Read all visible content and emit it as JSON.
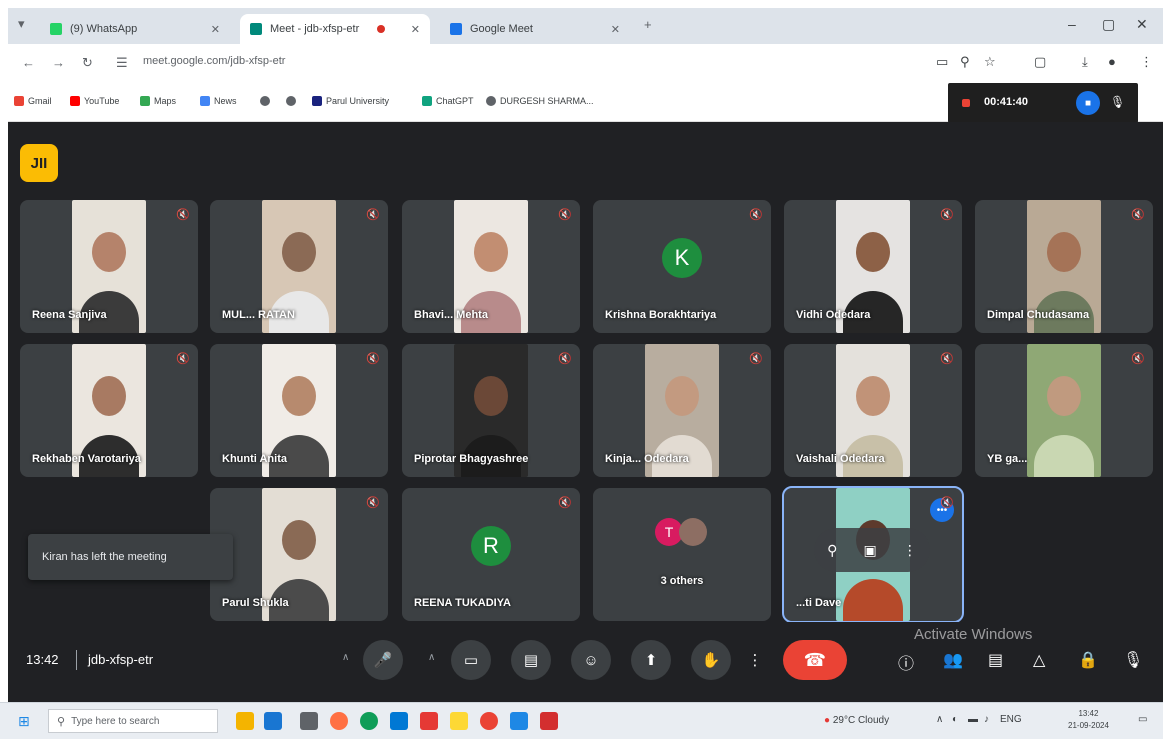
{
  "browser": {
    "tabs": [
      {
        "label": "(9) WhatsApp",
        "favicon_color": "#25d366"
      },
      {
        "label": "Meet - jdb-xfsp-etr",
        "favicon_color": "#00897b"
      },
      {
        "label": "Google Meet",
        "favicon_color": "#1a73e8"
      }
    ],
    "url": "meet.google.com/jdb-xfsp-etr",
    "bookmarks": [
      "Gmail",
      "YouTube",
      "Maps",
      "News",
      "Parul University",
      "ChatGPT",
      "DURGESH SHARMA..."
    ],
    "window_controls": {
      "minimize": "–",
      "maximize": "▢",
      "close": "✕"
    }
  },
  "recording": {
    "time": "00:41:40"
  },
  "meet": {
    "logo_label": "JII",
    "toast": "Kiran has left the meeting",
    "participants": [
      {
        "name": "Reena Sanjiva",
        "type": "video",
        "bg": "#e6e1d8",
        "skin": "#b5836b",
        "shirt": "#3b3b3b"
      },
      {
        "name": "MUL... RATAN",
        "type": "video",
        "bg": "#d7c7b5",
        "skin": "#8b6a55",
        "shirt": "#e8e8e8"
      },
      {
        "name": "Bhavi... Mehta",
        "type": "video",
        "bg": "#ece7e1",
        "skin": "#c28e72",
        "shirt": "#b88b8b"
      },
      {
        "name": "Krishna Borakhtariya",
        "type": "avatar",
        "initial": "K",
        "avatar_color": "#1e8e3e"
      },
      {
        "name": "Vidhi Odedara",
        "type": "video",
        "bg": "#e5e3e1",
        "skin": "#8d6147",
        "shirt": "#262626"
      },
      {
        "name": "Dimpal Chudasama",
        "type": "video",
        "bg": "#b9a995",
        "skin": "#a57357",
        "shirt": "#6d7a5e"
      },
      {
        "name": "Rekhaben Varotariya",
        "type": "video",
        "bg": "#ebe6df",
        "skin": "#a87a62",
        "shirt": "#2d2d2d"
      },
      {
        "name": "Khunti Anita",
        "type": "video",
        "bg": "#f0ece7",
        "skin": "#b78a6e",
        "shirt": "#4a4a4a"
      },
      {
        "name": "Piprotar Bhagyashree",
        "type": "video",
        "bg": "#2a2a2a",
        "skin": "#6b4837",
        "shirt": "#1c1c1c"
      },
      {
        "name": "Kinja... Odedara",
        "type": "video",
        "bg": "#b8ad9f",
        "skin": "#c39a80",
        "shirt": "#e2dbd2"
      },
      {
        "name": "Vaishali Odedara",
        "type": "video",
        "bg": "#e4e1dc",
        "skin": "#c19378",
        "shirt": "#c8c0a8"
      },
      {
        "name": "YB ga...",
        "type": "video",
        "bg": "#8fa875",
        "skin": "#c09a7f",
        "shirt": "#c9d7b2"
      },
      {
        "name": "Parul Shukla",
        "type": "video",
        "bg": "#e3ddd4",
        "skin": "#8a6a55",
        "shirt": "#4b4b4b"
      },
      {
        "name": "REENA TUKADIYA",
        "type": "avatar",
        "initial": "R",
        "avatar_color": "#1e8e3e"
      },
      {
        "name": "3 others",
        "type": "others",
        "initial": "T",
        "avatar_color": "#d81b60"
      },
      {
        "name": "...ti Dave",
        "type": "video",
        "bg": "#8fd0c4",
        "skin": "#5d3a2c",
        "shirt": "#b54a2a"
      }
    ]
  },
  "controls": {
    "time": "13:42",
    "meeting_code": "jdb-xfsp-etr",
    "watermark": "Activate Windows"
  },
  "taskbar": {
    "search_placeholder": "Type here to search",
    "weather": "29°C Cloudy",
    "language": "ENG",
    "clock_time": "13:42",
    "clock_date": "21-09-2024"
  }
}
